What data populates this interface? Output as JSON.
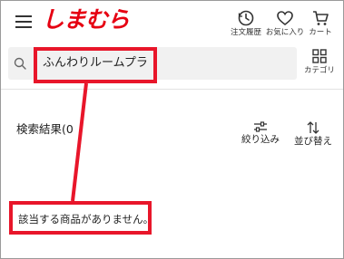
{
  "header": {
    "logo_text": "しまむら",
    "brand_color": "#e60012",
    "nav": {
      "history_label": "注文履歴",
      "favorites_label": "お気に入り",
      "cart_label": "カート"
    }
  },
  "search": {
    "value": "ふんわりルームプラ",
    "category_label": "カテゴリ"
  },
  "results": {
    "label": "検索結果(0",
    "filter_label": "絞り込み",
    "sort_label": "並び替え",
    "empty_message": "該当する商品がありません。"
  },
  "annotation": {
    "color": "#e8162a"
  }
}
